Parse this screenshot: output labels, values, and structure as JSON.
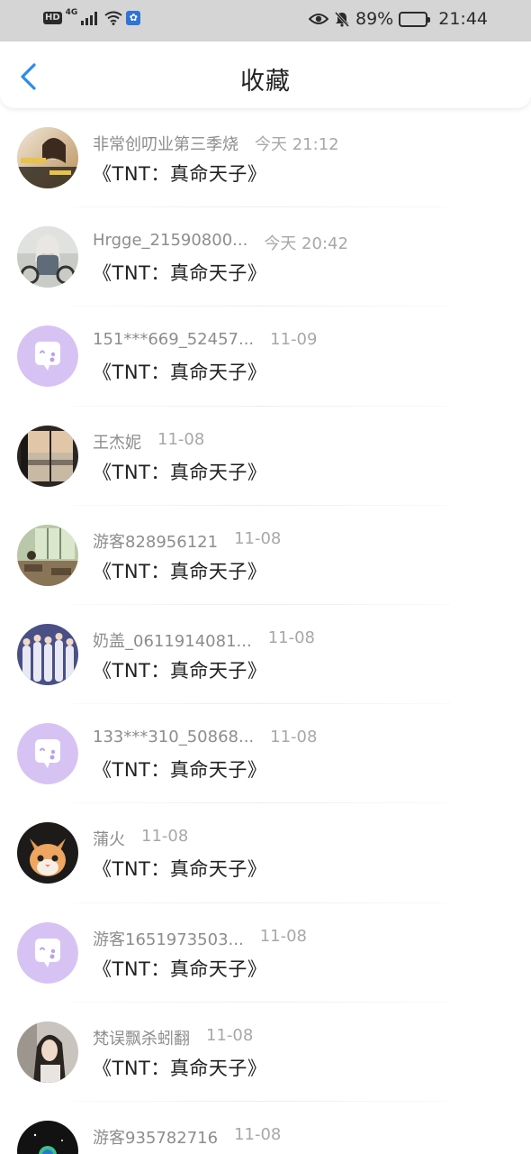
{
  "status_bar": {
    "left_badge": "HD",
    "network": "4G",
    "battery_percent": "89%",
    "battery_level": 0.89,
    "clock": "21:44"
  },
  "header": {
    "title": "收藏",
    "back_icon": "chevron-left-icon",
    "accent": "#2a8de8"
  },
  "favorites": [
    {
      "name": "非常创叨业第三季烧",
      "time": "今天 21:12",
      "title": "《TNT：真命天子》",
      "avatar": "photo-girl-text"
    },
    {
      "name": "Hrgge_21590800...",
      "time": "今天 20:42",
      "title": "《TNT：真命天子》",
      "avatar": "photo-girl-bike"
    },
    {
      "name": "151***669_52457...",
      "time": "11-09",
      "title": "《TNT：真命天子》",
      "avatar": "default-chat"
    },
    {
      "name": "王杰妮",
      "time": "11-08",
      "title": "《TNT：真命天子》",
      "avatar": "photo-window"
    },
    {
      "name": "游客828956121",
      "time": "11-08",
      "title": "《TNT：真命天子》",
      "avatar": "photo-classroom"
    },
    {
      "name": "奶盖_0611914081...",
      "time": "11-08",
      "title": "《TNT：真命天子》",
      "avatar": "photo-group"
    },
    {
      "name": "133***310_50868...",
      "time": "11-08",
      "title": "《TNT：真命天子》",
      "avatar": "default-chat"
    },
    {
      "name": "蒲火",
      "time": "11-08",
      "title": "《TNT：真命天子》",
      "avatar": "photo-kitten"
    },
    {
      "name": "游客1651973503...",
      "time": "11-08",
      "title": "《TNT：真命天子》",
      "avatar": "default-chat"
    },
    {
      "name": "梵误飘杀蚓翻",
      "time": "11-08",
      "title": "《TNT：真命天子》",
      "avatar": "photo-girl-portrait"
    },
    {
      "name": "游客935782716",
      "time": "11-08",
      "title": "",
      "avatar": "photo-dark-planet"
    }
  ]
}
